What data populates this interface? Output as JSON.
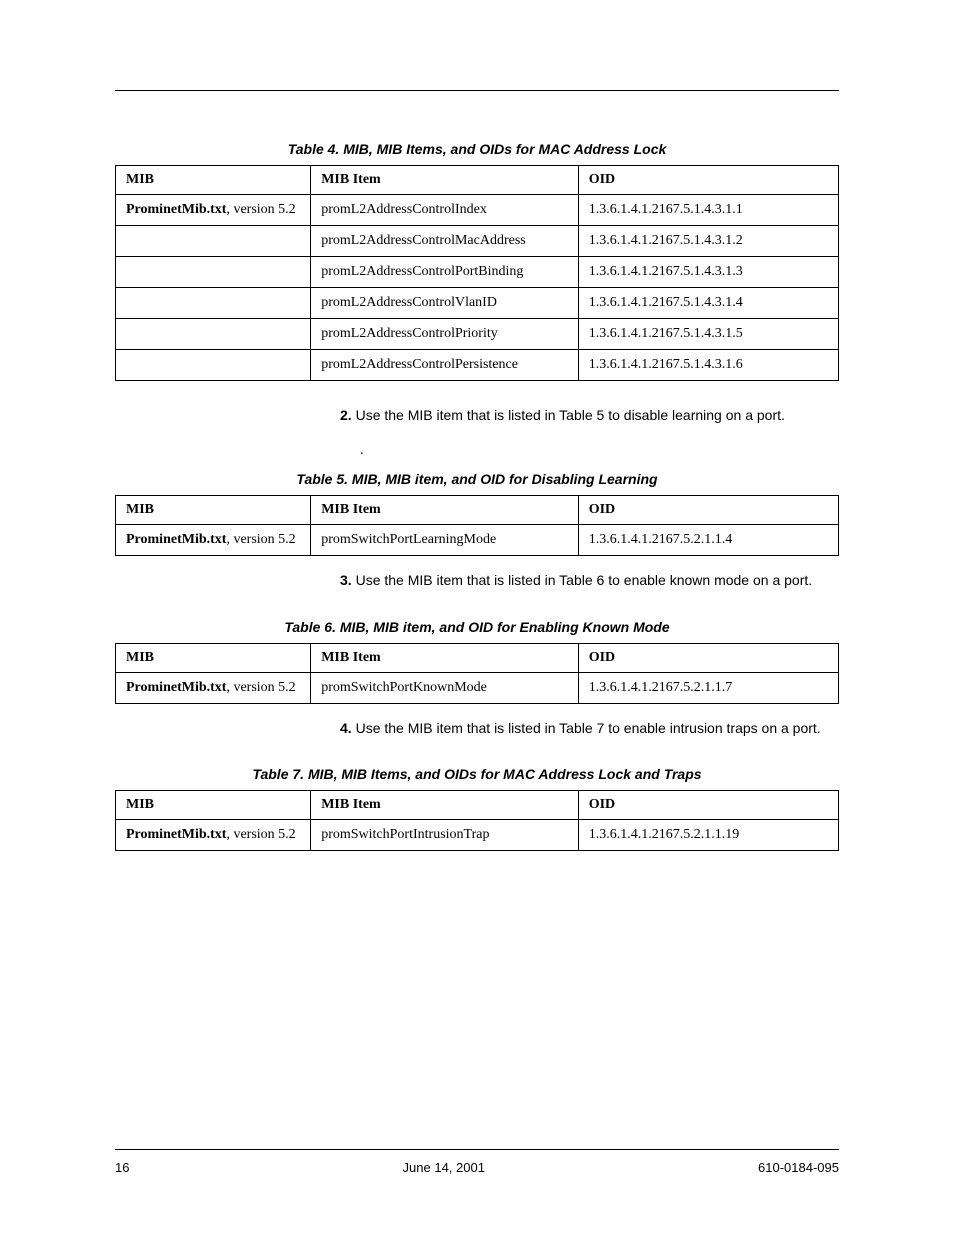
{
  "tables": {
    "t4": {
      "caption": "Table 4.  MIB, MIB Items, and OIDs for MAC Address Lock",
      "headers": [
        "MIB",
        "MIB Item",
        "OID"
      ],
      "rows": [
        {
          "mib_bold": "ProminetMib.txt",
          "mib_suffix": ", version 5.2",
          "item": "promL2AddressControlIndex",
          "oid": "1.3.6.1.4.1.2167.5.1.4.3.1.1"
        },
        {
          "mib_bold": "",
          "mib_suffix": "",
          "item": "promL2AddressControlMacAddress",
          "oid": "1.3.6.1.4.1.2167.5.1.4.3.1.2"
        },
        {
          "mib_bold": "",
          "mib_suffix": "",
          "item": "promL2AddressControlPortBinding",
          "oid": "1.3.6.1.4.1.2167.5.1.4.3.1.3"
        },
        {
          "mib_bold": "",
          "mib_suffix": "",
          "item": "promL2AddressControlVlanID",
          "oid": "1.3.6.1.4.1.2167.5.1.4.3.1.4"
        },
        {
          "mib_bold": "",
          "mib_suffix": "",
          "item": "promL2AddressControlPriority",
          "oid": "1.3.6.1.4.1.2167.5.1.4.3.1.5"
        },
        {
          "mib_bold": "",
          "mib_suffix": "",
          "item": "promL2AddressControlPersistence",
          "oid": "1.3.6.1.4.1.2167.5.1.4.3.1.6"
        }
      ]
    },
    "t5": {
      "caption": "Table 5.  MIB, MIB item, and OID for Disabling Learning",
      "headers": [
        "MIB",
        "MIB Item",
        "OID"
      ],
      "rows": [
        {
          "mib_bold": "ProminetMib.txt",
          "mib_suffix": ", version 5.2",
          "item": "promSwitchPortLearningMode",
          "oid": "1.3.6.1.4.1.2167.5.2.1.1.4"
        }
      ]
    },
    "t6": {
      "caption": "Table 6.  MIB, MIB item, and OID for Enabling Known Mode",
      "headers": [
        "MIB",
        "MIB Item",
        "OID"
      ],
      "rows": [
        {
          "mib_bold": "ProminetMib.txt",
          "mib_suffix": ", version 5.2",
          "item": "promSwitchPortKnownMode",
          "oid": "1.3.6.1.4.1.2167.5.2.1.1.7"
        }
      ]
    },
    "t7": {
      "caption": "Table 7.  MIB, MIB Items, and OIDs for MAC Address Lock and Traps",
      "headers": [
        "MIB",
        "MIB Item",
        "OID"
      ],
      "rows": [
        {
          "mib_bold": "ProminetMib.txt",
          "mib_suffix": ", version 5.2",
          "item": "promSwitchPortIntrusionTrap",
          "oid": "1.3.6.1.4.1.2167.5.2.1.1.19"
        }
      ]
    }
  },
  "steps": {
    "s2": {
      "num": "2.",
      "text": "Use the MIB item that is listed in Table 5 to disable learning on a port."
    },
    "s3": {
      "num": "3.",
      "text": "Use the MIB item that is listed in Table 6 to enable known mode on a port."
    },
    "s4": {
      "num": "4.",
      "text": "Use the MIB item that is listed in Table 7 to enable intrusion traps on a port."
    }
  },
  "dot": ".",
  "footer": {
    "page": "16",
    "date": "June 14, 2001",
    "docnum": "610-0184-095"
  }
}
